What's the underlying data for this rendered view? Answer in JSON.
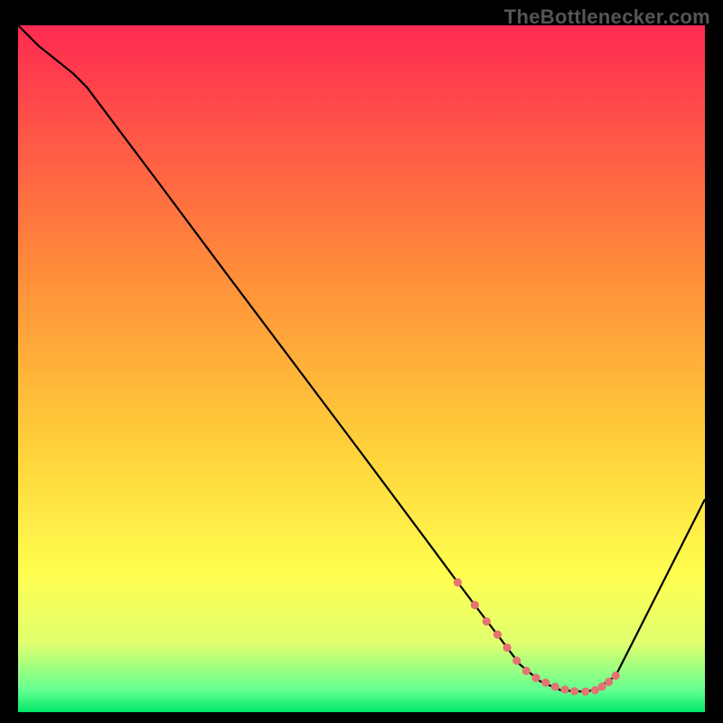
{
  "watermark": "TheBottlenecker.com",
  "chart_data": {
    "type": "line",
    "title": "",
    "xlabel": "",
    "ylabel": "",
    "xlim": [
      0,
      100
    ],
    "ylim": [
      0,
      100
    ],
    "grid": false,
    "background_gradient": {
      "stops": [
        {
          "offset": 0,
          "color": "#ff2a52"
        },
        {
          "offset": 35,
          "color": "#ff8a3a"
        },
        {
          "offset": 62,
          "color": "#ffd23a"
        },
        {
          "offset": 80,
          "color": "#ffff50"
        },
        {
          "offset": 90,
          "color": "#e0ff70"
        },
        {
          "offset": 97,
          "color": "#60ff90"
        },
        {
          "offset": 100,
          "color": "#00e868"
        }
      ]
    },
    "series": [
      {
        "name": "bottleneck-curve",
        "color": "#000000",
        "x": [
          0,
          3,
          8,
          10,
          20,
          30,
          40,
          50,
          60,
          64,
          68,
          70,
          73,
          76,
          79,
          82,
          84,
          87,
          90,
          95,
          100
        ],
        "y": [
          100,
          97,
          93,
          91,
          77.7,
          64.3,
          51,
          37.7,
          24.3,
          18.9,
          13.6,
          11,
          7,
          4.5,
          3.2,
          3.0,
          3.2,
          5.3,
          11.2,
          21.1,
          31
        ]
      }
    ],
    "markers": {
      "name": "highlight-points",
      "color": "#e57373",
      "radius": 4.6,
      "x": [
        64,
        66.5,
        68.2,
        69.8,
        71.2,
        72.6,
        74,
        75.4,
        76.8,
        78.2,
        79.6,
        81,
        82.6,
        84,
        85,
        86,
        87
      ],
      "y": [
        18.9,
        15.6,
        13.2,
        11.3,
        9.4,
        7.5,
        6.0,
        5.0,
        4.3,
        3.7,
        3.3,
        3.05,
        3.0,
        3.2,
        3.7,
        4.4,
        5.3
      ]
    }
  }
}
